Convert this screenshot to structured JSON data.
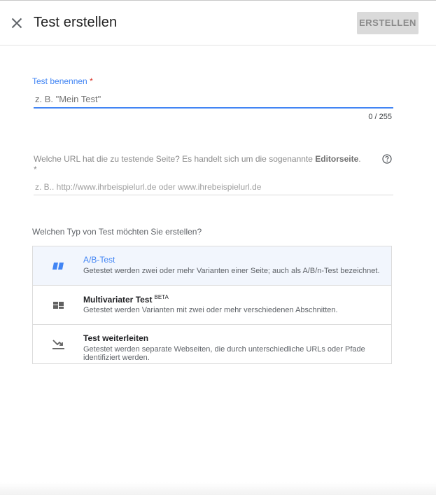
{
  "header": {
    "title": "Test erstellen",
    "create_label": "ERSTELLEN",
    "close_icon": "close-icon"
  },
  "name_field": {
    "label": "Test benennen",
    "required_marker": "*",
    "placeholder": "z. B. \"Mein Test\"",
    "value": "",
    "counter": "0 / 255"
  },
  "url_field": {
    "question_prefix": "Welche URL hat die zu testende Seite? Es handelt sich um die sogenannte",
    "question_bold": "Editorseite",
    "question_suffix": ". *",
    "placeholder": "z. B.. http://www.ihrbeispielurl.de oder www.ihrebeispielurl.de",
    "value": "",
    "help_icon": "help-icon"
  },
  "test_type": {
    "question": "Welchen Typ von Test möchten Sie erstellen?",
    "options": [
      {
        "title": "A/B-Test",
        "badge": "",
        "description": "Getestet werden zwei oder mehr Varianten einer Seite; auch als A/B/n-Test bezeichnet.",
        "icon": "ab-test-icon",
        "selected": true
      },
      {
        "title": "Multivariater Test",
        "badge": "BETA",
        "description": "Getestet werden Varianten mit zwei oder mehr verschiedenen Abschnitten.",
        "icon": "multivariate-icon",
        "selected": false
      },
      {
        "title": "Test weiterleiten",
        "badge": "",
        "description": "Getestet werden separate Webseiten, die durch unterschiedliche URLs oder Pfade identifiziert werden.",
        "icon": "redirect-icon",
        "selected": false
      }
    ]
  },
  "colors": {
    "accent": "#4285f4",
    "required": "#d93025",
    "selected_bg": "#f2f6fd",
    "disabled_button_bg": "#dadada"
  }
}
